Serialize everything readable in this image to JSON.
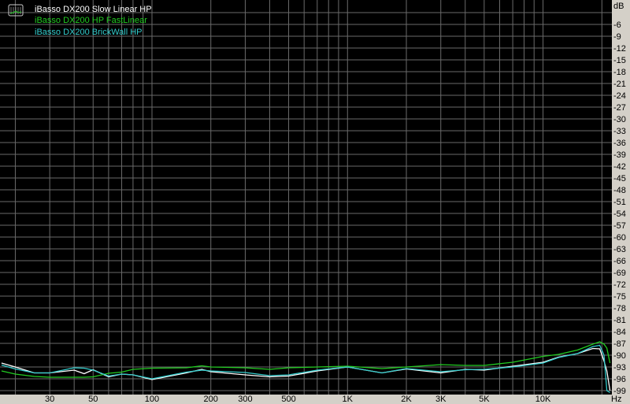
{
  "chart_data": {
    "type": "line",
    "title": "",
    "xlabel": "Hz",
    "ylabel": "dB",
    "xscale": "log",
    "xlim": [
      16.7,
      22500
    ],
    "ylim": [
      -100,
      0
    ],
    "grid": true,
    "legend_position": "top-left",
    "y_ticks": [
      -6,
      -9,
      -12,
      -15,
      -18,
      -21,
      -24,
      -27,
      -30,
      -33,
      -36,
      -39,
      -42,
      -45,
      -48,
      -51,
      -54,
      -57,
      -60,
      -63,
      -66,
      -69,
      -72,
      -75,
      -78,
      -81,
      -84,
      -87,
      -90,
      -93,
      -96,
      -99
    ],
    "x_ticks": [
      {
        "value": 30,
        "label": "30"
      },
      {
        "value": 50,
        "label": "50"
      },
      {
        "value": 100,
        "label": "100"
      },
      {
        "value": 200,
        "label": "200"
      },
      {
        "value": 300,
        "label": "300"
      },
      {
        "value": 500,
        "label": "500"
      },
      {
        "value": 1000,
        "label": "1K"
      },
      {
        "value": 2000,
        "label": "2K"
      },
      {
        "value": 3000,
        "label": "3K"
      },
      {
        "value": 5000,
        "label": "5K"
      },
      {
        "value": 10000,
        "label": "10K"
      }
    ],
    "x": [
      17,
      20,
      25,
      30,
      40,
      45,
      50,
      60,
      70,
      80,
      100,
      150,
      180,
      200,
      300,
      400,
      500,
      700,
      1000,
      1500,
      2000,
      3000,
      4000,
      5000,
      7000,
      10000,
      12000,
      15000,
      18000,
      19500,
      20500,
      21200,
      22000
    ],
    "series": [
      {
        "name": "iBasso DX200 Slow Linear HP",
        "color": "#ffffff",
        "values": [
          -92,
          -93,
          -94.5,
          -94.5,
          -93.8,
          -94.7,
          -93.7,
          -95.5,
          -94.8,
          -95,
          -96.2,
          -94.5,
          -93.6,
          -94.2,
          -95,
          -95.5,
          -95.3,
          -94,
          -93,
          -94.5,
          -93.5,
          -94.5,
          -93.6,
          -93.8,
          -92.8,
          -91.8,
          -90.5,
          -89.6,
          -88.3,
          -88.4,
          -91.5,
          -94,
          -99
        ]
      },
      {
        "name": "iBasso DX200 HP FastLinear",
        "color": "#22cc22",
        "values": [
          -94,
          -94.8,
          -95.4,
          -95.6,
          -95.6,
          -95.6,
          -95.5,
          -94.6,
          -94.3,
          -93.6,
          -93.3,
          -93.2,
          -92.7,
          -93,
          -93.2,
          -93.6,
          -93.2,
          -93,
          -92.8,
          -93.4,
          -93,
          -92.4,
          -92.6,
          -92.6,
          -91.8,
          -90.3,
          -89.8,
          -88.7,
          -87.2,
          -86.6,
          -87.2,
          -88.2,
          -92
        ]
      },
      {
        "name": "iBasso DX200 BrickWall HP",
        "color": "#33cccc",
        "values": [
          -92.5,
          -93.5,
          -94.5,
          -94.5,
          -93.2,
          -93.3,
          -93.8,
          -95.3,
          -94.8,
          -95,
          -96,
          -94.3,
          -93.8,
          -94,
          -94.4,
          -95.2,
          -95,
          -93.8,
          -93,
          -94.5,
          -93.4,
          -94.2,
          -93.7,
          -93.6,
          -93,
          -92,
          -90.6,
          -89.6,
          -87.8,
          -87.5,
          -90,
          -99,
          -99.5
        ]
      }
    ]
  }
}
